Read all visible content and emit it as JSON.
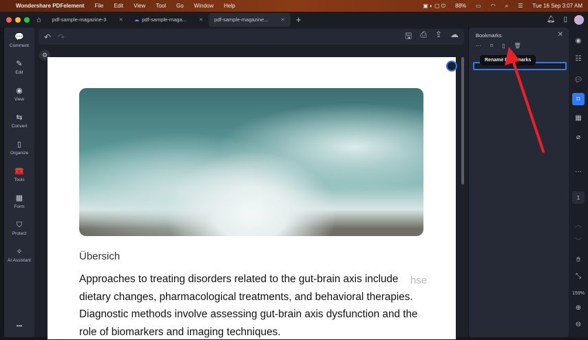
{
  "menubar": {
    "app": "Wondershare PDFelement",
    "items": [
      "File",
      "Edit",
      "View",
      "Tool",
      "Go",
      "Window",
      "Help"
    ],
    "battery": "88%",
    "datetime": "Tue 16 Sep  3:07 AM"
  },
  "tabs": [
    {
      "label": "pdf-sample-magazine-3"
    },
    {
      "label": "pdf-sample-maga..."
    },
    {
      "label": "pdf-sample-magazine..."
    }
  ],
  "leftbar": [
    {
      "label": "Comment",
      "icon": "💬"
    },
    {
      "label": "Edit",
      "icon": "✎"
    },
    {
      "label": "View",
      "icon": "◉"
    },
    {
      "label": "Convert",
      "icon": "⇆"
    },
    {
      "label": "Organize",
      "icon": "▯"
    },
    {
      "label": "Tools",
      "icon": "🧰"
    },
    {
      "label": "Form",
      "icon": "▦"
    },
    {
      "label": "Protect",
      "icon": "⛉"
    },
    {
      "label": "AI Assistant",
      "icon": "✧"
    }
  ],
  "more": "•••",
  "document": {
    "heading": "Übersich",
    "lines": [
      "Approaches to treating disorders related to the gut-brain axis include",
      "dietary changes, pharmacological treatments, and behavioral therapies.",
      "Diagnostic methods involve assessing gut-brain axis dysfunction and the",
      "role of biomarkers and imaging techniques."
    ],
    "ghost": "hse"
  },
  "bookmarks": {
    "title": "Bookmarks",
    "tooltip": "Rename Bookmarks"
  },
  "rightbar": {
    "page": "1",
    "zoom": "159%"
  },
  "colors": {
    "accent": "#2f7bf5",
    "arrow": "#e8202a"
  }
}
